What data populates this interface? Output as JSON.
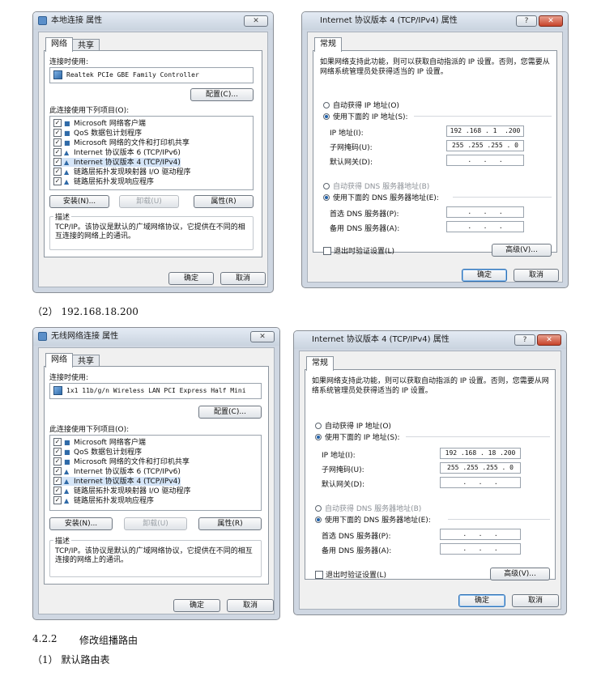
{
  "captions": {
    "fig2": "（2）  192.168.18.200",
    "section_num": "4.2.2",
    "section_title": "修改组播路由",
    "item1": "（1）  默认路由表"
  },
  "dialog1": {
    "title": "本地连接 属性",
    "tabs": [
      "网络",
      "共享"
    ],
    "connect_using_label": "连接时使用:",
    "adapter": "Realtek PCIe GBE Family Controller",
    "configure_btn": "配置(C)...",
    "items_label": "此连接使用下列项目(O):",
    "items": [
      "Microsoft 网络客户端",
      "QoS 数据包计划程序",
      "Microsoft 网络的文件和打印机共享",
      "Internet 协议版本 6 (TCP/IPv6)",
      "Internet 协议版本 4 (TCP/IPv4)",
      "链路层拓扑发现映射器 I/O 驱动程序",
      "链路层拓扑发现响应程序"
    ],
    "install_btn": "安装(N)...",
    "uninstall_btn": "卸载(U)",
    "properties_btn": "属性(R)",
    "desc_legend": "描述",
    "desc_text": "TCP/IP。该协议是默认的广域网络协议，它提供在不同的相互连接的网络上的通讯。",
    "ok_btn": "确定",
    "cancel_btn": "取消"
  },
  "ipv4_1": {
    "title": "Internet 协议版本 4 (TCP/IPv4) 属性",
    "tab": "常规",
    "intro": "如果网络支持此功能，则可以获取自动指派的 IP 设置。否则，您需要从网络系统管理员处获得适当的 IP 设置。",
    "auto_ip": "自动获得 IP 地址(O)",
    "manual_ip": "使用下面的 IP 地址(S):",
    "ip_label": "IP 地址(I):",
    "ip_value": "192 .168 . 1  .200",
    "mask_label": "子网掩码(U):",
    "mask_value": "255 .255 .255 . 0",
    "gateway_label": "默认网关(D):",
    "gateway_value": " .   .   . ",
    "auto_dns": "自动获得 DNS 服务器地址(B)",
    "manual_dns": "使用下面的 DNS 服务器地址(E):",
    "dns1_label": "首选 DNS 服务器(P):",
    "dns1_value": " .   .   . ",
    "dns2_label": "备用 DNS 服务器(A):",
    "dns2_value": " .   .   . ",
    "validate_label": "退出时验证设置(L)",
    "advanced_btn": "高级(V)...",
    "ok_btn": "确定",
    "cancel_btn": "取消",
    "help_btn": "?"
  },
  "dialog2": {
    "title": "无线网络连接 属性",
    "tabs": [
      "网络",
      "共享"
    ],
    "connect_using_label": "连接时使用:",
    "adapter": "1x1 11b/g/n Wireless LAN PCI Express Half Mini",
    "configure_btn": "配置(C)...",
    "items_label": "此连接使用下列项目(O):",
    "items": [
      "Microsoft 网络客户端",
      "QoS 数据包计划程序",
      "Microsoft 网络的文件和打印机共享",
      "Internet 协议版本 6 (TCP/IPv6)",
      "Internet 协议版本 4 (TCP/IPv4)",
      "链路层拓扑发现映射器 I/O 驱动程序",
      "链路层拓扑发现响应程序"
    ],
    "install_btn": "安装(N)...",
    "uninstall_btn": "卸载(U)",
    "properties_btn": "属性(R)",
    "desc_legend": "描述",
    "desc_text": "TCP/IP。该协议是默认的广域网络协议，它提供在不同的相互连接的网络上的通讯。",
    "ok_btn": "确定",
    "cancel_btn": "取消"
  },
  "ipv4_2": {
    "title": "Internet 协议版本 4 (TCP/IPv4) 属性",
    "tab": "常规",
    "intro": "如果网络支持此功能，则可以获取自动指派的 IP 设置。否则，您需要从网络系统管理员处获得适当的 IP 设置。",
    "auto_ip": "自动获得 IP 地址(O)",
    "manual_ip": "使用下面的 IP 地址(S):",
    "ip_label": "IP 地址(I):",
    "ip_value": "192 .168 . 18 .200",
    "mask_label": "子网掩码(U):",
    "mask_value": "255 .255 .255 . 0",
    "gateway_label": "默认网关(D):",
    "gateway_value": " .   .   . ",
    "auto_dns": "自动获得 DNS 服务器地址(B)",
    "manual_dns": "使用下面的 DNS 服务器地址(E):",
    "dns1_label": "首选 DNS 服务器(P):",
    "dns1_value": " .   .   . ",
    "dns2_label": "备用 DNS 服务器(A):",
    "dns2_value": " .   .   . ",
    "validate_label": "退出时验证设置(L)",
    "advanced_btn": "高级(V)...",
    "ok_btn": "确定",
    "cancel_btn": "取消",
    "help_btn": "?"
  }
}
